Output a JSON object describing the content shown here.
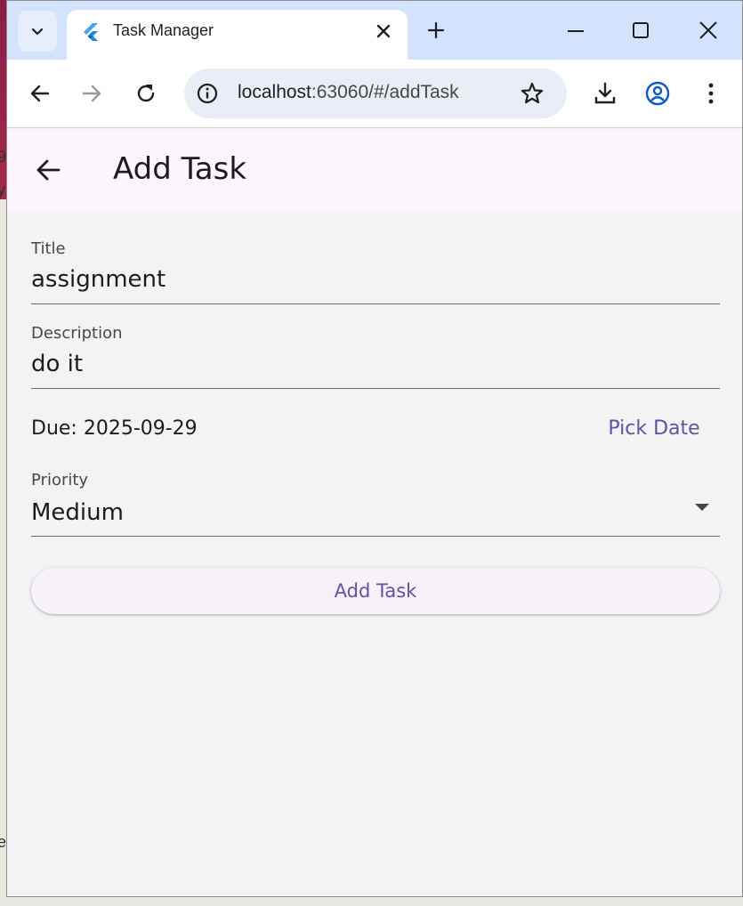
{
  "browser": {
    "tab_title": "Task Manager",
    "url_host": "localhost",
    "url_path": ":63060/#/addTask"
  },
  "appbar": {
    "title": "Add Task"
  },
  "form": {
    "title_label": "Title",
    "title_value": "assignment",
    "description_label": "Description",
    "description_value": "do it",
    "due_text": "Due: 2025-09-29",
    "pick_date_label": "Pick Date",
    "priority_label": "Priority",
    "priority_value": "Medium",
    "submit_label": "Add Task"
  },
  "icons": {
    "tab_search": "chevron-down-icon",
    "favicon": "flutter-logo-icon",
    "tab_close": "close-icon",
    "new_tab": "plus-icon",
    "minimize": "minimize-icon",
    "maximize": "maximize-icon",
    "window_close": "close-icon",
    "back": "arrow-back-icon",
    "forward": "arrow-forward-icon",
    "reload": "reload-icon",
    "site_info": "info-icon",
    "bookmark": "star-icon",
    "downloads": "download-icon",
    "profile": "profile-icon",
    "menu": "more-vert-icon",
    "app_back": "arrow-back-icon",
    "dropdown": "arrow-drop-down-icon"
  },
  "colors": {
    "tabstrip": "#d3e3fd",
    "appbar": "#fdf6fe",
    "accent": "#6650a4",
    "background": "#f3f3f3"
  }
}
